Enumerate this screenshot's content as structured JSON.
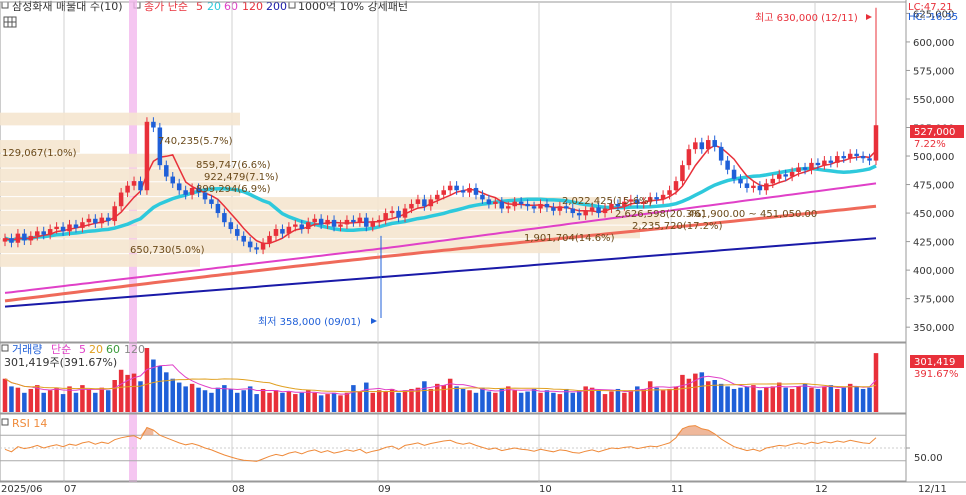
{
  "header": {
    "stock_name": "삼성화재 매물대 수(10)",
    "legend": [
      {
        "text": "종가 단순",
        "color": "#e8303a"
      },
      {
        "text": "5",
        "color": "#e8303a"
      },
      {
        "text": "20",
        "color": "#2ec9dc"
      },
      {
        "text": "60",
        "color": "#e040c8"
      },
      {
        "text": "120",
        "color": "#e8303a"
      },
      {
        "text": "200",
        "color": "#1a1aa8"
      }
    ],
    "extra": "1000억 10% 강세패턴"
  },
  "price_axis": {
    "ticks": [
      "625,000",
      "600,000",
      "575,000",
      "550,000",
      "525,000",
      "500,000",
      "475,000",
      "450,000",
      "425,000",
      "400,000",
      "375,000",
      "350,000"
    ],
    "lc_label": "LC:47.21",
    "hc_label": "HC:-16.35",
    "current_price": "527,000",
    "current_change": "7.22%"
  },
  "annotations": {
    "high": "최고 630,000 (12/11)",
    "low": "최저 358,000 (09/01)"
  },
  "volume_profile_labels": [
    "740,235(5.7%)",
    "129,067(1.0%)",
    "859,747(6.6%)",
    "922,479(7.1%)",
    "899,294(6.9%)",
    "2,022,425(15.6%)",
    "2,626,598(20.3%)",
    "461,900.00 ~ 451,050.00",
    "2,235,720(17.2%)",
    "1,901,704(14.6%)",
    "650,730(5.0%)"
  ],
  "volume_panel": {
    "legend_title": "거래량",
    "legend_items": [
      {
        "text": "단순",
        "color": "#e040c8"
      },
      {
        "text": "5",
        "color": "#e040c8"
      },
      {
        "text": "20",
        "color": "#e0a020"
      },
      {
        "text": "60",
        "color": "#3a9a3a"
      },
      {
        "text": "120",
        "color": "#888888"
      }
    ],
    "value_label": "301,419주(391.67%)",
    "badge_value": "301,419",
    "badge_change": "391.67%"
  },
  "rsi_panel": {
    "title": "RSI 14",
    "tick": "50.00"
  },
  "x_axis": {
    "labels": [
      "2025/06",
      "07",
      "08",
      "09",
      "10",
      "11",
      "12",
      "12/11"
    ]
  },
  "colors": {
    "up": "#e8303a",
    "down": "#1f5fd8",
    "ma5": "#e8303a",
    "ma20": "#2ec9dc",
    "ma60": "#e040c8",
    "ma120": "#ef6a5a",
    "ma200": "#1a1aa8",
    "volume_band": "#f5e6cf",
    "highlight": "#f3b8ee",
    "rsi": "#ef8a3a"
  },
  "chart_data": {
    "type": "candlestick",
    "price_range": [
      337000,
      635000
    ],
    "high": {
      "date": "12/11",
      "value": 630000
    },
    "low": {
      "date": "09/01",
      "value": 358000
    },
    "last_close": 527000,
    "volume_profile": [
      {
        "price_low": 526000,
        "price_high": 538000,
        "volume": 740235,
        "pct": 5.7
      },
      {
        "price_low": 502000,
        "price_high": 514000,
        "volume": 129067,
        "pct": 1.0
      },
      {
        "price_low": 489000,
        "price_high": 502000,
        "volume": 859747,
        "pct": 6.6
      },
      {
        "price_low": 477000,
        "price_high": 489000,
        "volume": 922479,
        "pct": 7.1
      },
      {
        "price_low": 464000,
        "price_high": 477000,
        "volume": 899294,
        "pct": 6.9
      },
      {
        "price_low": 452000,
        "price_high": 464000,
        "volume": 2022425,
        "pct": 15.6
      },
      {
        "price_low": 439000,
        "price_high": 452000,
        "volume": 2626598,
        "pct": 20.3
      },
      {
        "price_low": 427000,
        "price_high": 439000,
        "volume": 2235720,
        "pct": 17.2
      },
      {
        "price_low": 414000,
        "price_high": 427000,
        "volume": 1901704,
        "pct": 14.6
      },
      {
        "price_low": 402000,
        "price_high": 414000,
        "volume": 650730,
        "pct": 5.0
      }
    ],
    "closes": [
      428000,
      424000,
      432000,
      426000,
      430000,
      434000,
      431000,
      436000,
      438000,
      434000,
      440000,
      437000,
      442000,
      445000,
      441000,
      446000,
      443000,
      456000,
      468000,
      474000,
      478000,
      470000,
      530000,
      525000,
      492000,
      482000,
      476000,
      470000,
      466000,
      472000,
      468000,
      462000,
      458000,
      450000,
      442000,
      436000,
      430000,
      425000,
      420000,
      418000,
      424000,
      430000,
      436000,
      432000,
      438000,
      440000,
      436000,
      442000,
      445000,
      440000,
      444000,
      438000,
      440000,
      444000,
      442000,
      446000,
      438000,
      442000,
      444000,
      450000,
      452000,
      446000,
      454000,
      458000,
      462000,
      456000,
      462000,
      466000,
      470000,
      474000,
      470000,
      468000,
      472000,
      466000,
      462000,
      458000,
      460000,
      454000,
      456000,
      460000,
      458000,
      456000,
      454000,
      458000,
      455000,
      452000,
      456000,
      454000,
      450000,
      448000,
      452000,
      455000,
      450000,
      454000,
      458000,
      456000,
      460000,
      462000,
      458000,
      460000,
      464000,
      462000,
      466000,
      470000,
      478000,
      492000,
      506000,
      512000,
      506000,
      514000,
      508000,
      496000,
      488000,
      480000,
      476000,
      472000,
      474000,
      470000,
      476000,
      480000,
      484000,
      482000,
      486000,
      490000,
      488000,
      494000,
      492000,
      496000,
      494000,
      500000,
      498000,
      502000,
      500000,
      498000,
      496000,
      527000
    ],
    "rsi": [
      48,
      44,
      52,
      49,
      51,
      54,
      50,
      53,
      55,
      52,
      56,
      54,
      58,
      60,
      56,
      59,
      57,
      63,
      66,
      68,
      69,
      64,
      82,
      78,
      70,
      66,
      62,
      58,
      55,
      57,
      54,
      50,
      47,
      43,
      39,
      36,
      33,
      31,
      30,
      29,
      33,
      37,
      40,
      38,
      42,
      44,
      41,
      45,
      47,
      43,
      46,
      42,
      44,
      47,
      45,
      48,
      42,
      45,
      47,
      51,
      53,
      48,
      54,
      56,
      58,
      54,
      57,
      59,
      61,
      62,
      58,
      56,
      58,
      54,
      51,
      48,
      50,
      46,
      48,
      50,
      48,
      47,
      45,
      48,
      46,
      44,
      47,
      46,
      43,
      42,
      45,
      47,
      44,
      47,
      50,
      49,
      51,
      52,
      49,
      51,
      53,
      52,
      55,
      58,
      66,
      80,
      84,
      85,
      80,
      78,
      72,
      64,
      58,
      52,
      49,
      46,
      48,
      45,
      50,
      52,
      54,
      53,
      56,
      58,
      56,
      59,
      57,
      60,
      58,
      61,
      59,
      62,
      60,
      58,
      57,
      66
    ],
    "volume": [
      52,
      40,
      38,
      30,
      36,
      42,
      30,
      34,
      38,
      28,
      40,
      30,
      42,
      36,
      30,
      38,
      34,
      50,
      66,
      58,
      60,
      48,
      100,
      82,
      72,
      62,
      52,
      46,
      40,
      44,
      38,
      34,
      30,
      38,
      42,
      36,
      30,
      34,
      40,
      28,
      36,
      30,
      34,
      30,
      32,
      28,
      30,
      34,
      30,
      26,
      28,
      30,
      26,
      30,
      42,
      32,
      46,
      30,
      34,
      32,
      36,
      30,
      34,
      36,
      38,
      48,
      36,
      44,
      42,
      52,
      40,
      36,
      34,
      30,
      38,
      32,
      30,
      36,
      40,
      34,
      30,
      32,
      36,
      30,
      34,
      30,
      28,
      36,
      30,
      34,
      40,
      38,
      34,
      28,
      32,
      36,
      30,
      34,
      40,
      36,
      48,
      38,
      34,
      36,
      40,
      58,
      52,
      60,
      62,
      48,
      50,
      44,
      40,
      36,
      38,
      40,
      42,
      34,
      38,
      40,
      46,
      38,
      36,
      40,
      44,
      38,
      36,
      40,
      42,
      36,
      38,
      44,
      40,
      36,
      38,
      92
    ]
  }
}
